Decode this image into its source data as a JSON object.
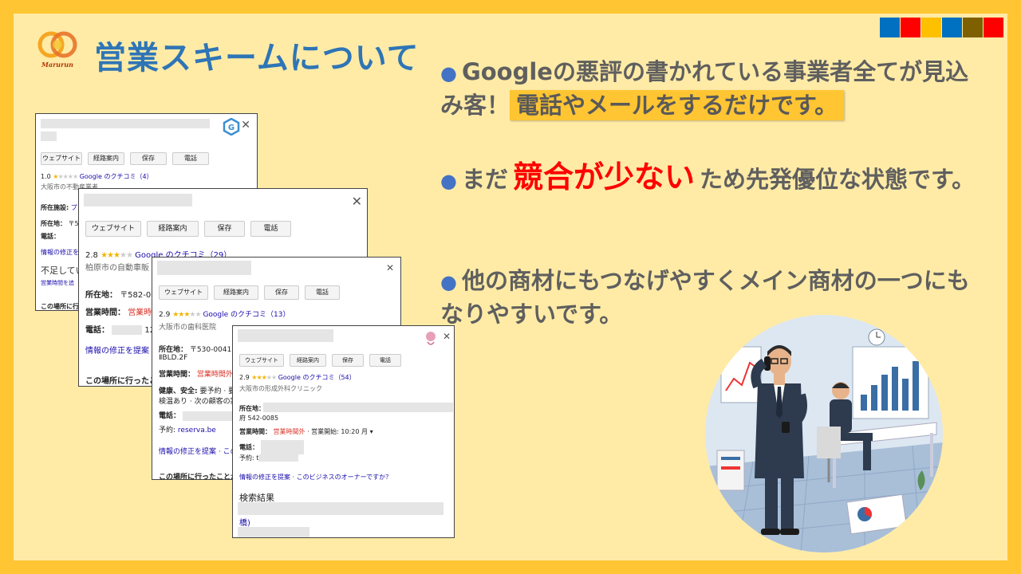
{
  "slide": {
    "title": "営業スキームについて",
    "logo_text": "Marurun",
    "corner_colors": [
      "#0070C0",
      "#FF0000",
      "#FFC000",
      "#0070C0",
      "#7F6000",
      "#FF0000"
    ]
  },
  "bullets": [
    {
      "pre": "Googleの悪評の書かれている事業者全てが見込み客！",
      "highlight": "電話やメールをするだけです。"
    },
    {
      "pre": "まだ",
      "emphasis": "競合が少ない",
      "post": "ため先発優位な状態です。"
    },
    {
      "pre": "他の商材にもつなげやすくメイン商材の一つにもなりやすいです。"
    }
  ],
  "card_buttons": [
    "ウェブサイト",
    "経路案内",
    "保存",
    "電話"
  ],
  "cards": [
    {
      "rating": "1.0",
      "review_link": "Google のクチコミ（4）",
      "category": "大阪市の不動産業者",
      "facility_label": "所在施設:",
      "facility_value": "プ",
      "address_label": "所在地：",
      "address_value": "〒53",
      "phone_label": "電話：",
      "suggest_link": "情報の修正を",
      "lacking": "不足してい",
      "hours_link": "営業時間を追",
      "visited": "この場所に行っ"
    },
    {
      "rating": "2.8",
      "review_link": "Google のクチコミ（29）",
      "category": "柏原市の自動車販",
      "address_label": "所在地：",
      "address_value": "〒582-00",
      "hours_label": "営業時間：",
      "hours_value": "営業時",
      "phone_label": "電話：",
      "phone_value": "12",
      "suggest_link": "情報の修正を提案",
      "visited": "この場所に行ったこ"
    },
    {
      "rating": "2.9",
      "review_link": "Google のクチコミ（13）",
      "category": "大阪市の歯科医院",
      "address_label": "所在地：",
      "address_value": "〒530-0041 大",
      "address_line2": "ⅡBLD.2F",
      "hours_label": "営業時間：",
      "hours_value": "営業時間外",
      "health_label": "健康、安全:",
      "health_value": "要予約 · 要",
      "health_line2": "検温あり · 次の顧客の案",
      "phone_label": "電話：",
      "reserve_label": "予約:",
      "reserve_value": "reserva.be",
      "suggest_link": "情報の修正を提案 · この",
      "visited": "この場所に行ったことが"
    },
    {
      "rating": "2.9",
      "review_link": "Google のクチコミ（54）",
      "category": "大阪市の形成外科クリニック",
      "address_label": "所在地：",
      "address_value": "府 542-0085",
      "hours_label": "営業時間：",
      "hours_closed": "営業時間外",
      "hours_open": "· 営業開始: 10:20 月",
      "phone_label": "電話：",
      "reserve_label": "予約:",
      "reserve_value": "t",
      "suggest_link": "情報の修正を提案 · このビジネスのオーナーですか？",
      "search_results": "検索結果",
      "search_frag": "橋)"
    }
  ]
}
